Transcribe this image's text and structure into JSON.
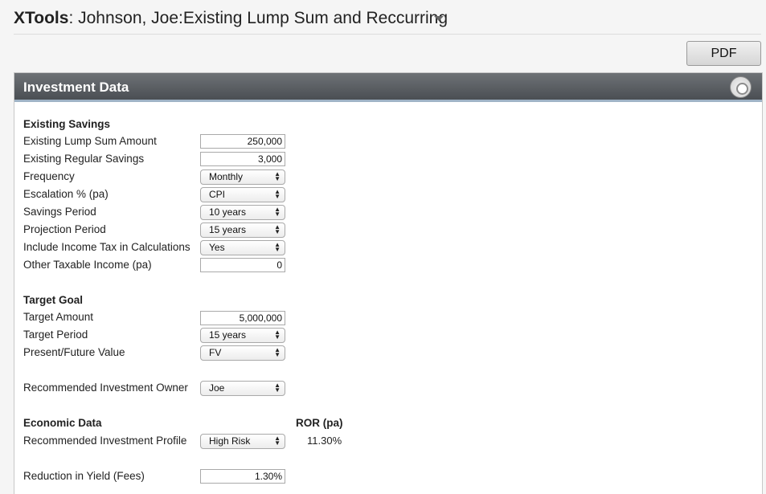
{
  "header": {
    "brand": "XTools",
    "title": ": Johnson, Joe:Existing Lump Sum and Reccurring"
  },
  "toolbar": {
    "pdf_label": "PDF"
  },
  "panel": {
    "title": "Investment Data",
    "settings_icon": "gear-icon"
  },
  "existing_savings": {
    "heading": "Existing Savings",
    "lump_sum_label": "Existing Lump Sum Amount",
    "lump_sum_value": "250,000",
    "regular_label": "Existing Regular Savings",
    "regular_value": "3,000",
    "frequency_label": "Frequency",
    "frequency_value": "Monthly",
    "escalation_label": "Escalation % (pa)",
    "escalation_value": "CPI",
    "savings_period_label": "Savings Period",
    "savings_period_value": "10 years",
    "projection_label": "Projection Period",
    "projection_value": "15 years",
    "tax_label": "Include Income Tax in Calculations",
    "tax_value": "Yes",
    "other_income_label": "Other Taxable Income (pa)",
    "other_income_value": "0"
  },
  "target_goal": {
    "heading": "Target Goal",
    "amount_label": "Target Amount",
    "amount_value": "5,000,000",
    "period_label": "Target Period",
    "period_value": "15 years",
    "pv_fv_label": "Present/Future Value",
    "pv_fv_value": "FV"
  },
  "owner": {
    "label": "Recommended Investment Owner",
    "value": "Joe"
  },
  "economic": {
    "heading": "Economic Data",
    "ror_heading": "ROR (pa)",
    "profile_label": "Recommended Investment Profile",
    "profile_value": "High Risk",
    "ror_value": "11.30%",
    "fees_label": "Reduction in Yield (Fees)",
    "fees_value": "1.30%"
  }
}
